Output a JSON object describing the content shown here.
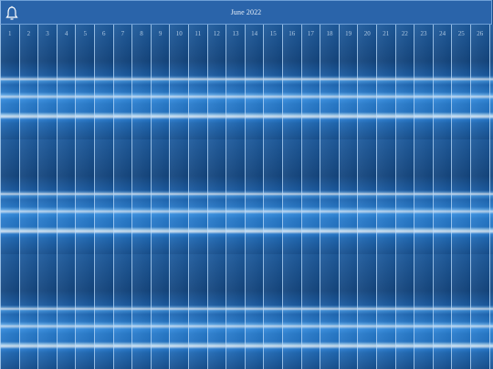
{
  "header": {
    "title": "June 2022",
    "bell_icon": "bell-icon"
  },
  "days": [
    "1",
    "2",
    "3",
    "4",
    "5",
    "6",
    "7",
    "8",
    "9",
    "10",
    "11",
    "12",
    "13",
    "14",
    "15",
    "16",
    "17",
    "18",
    "19",
    "20",
    "21",
    "22",
    "23",
    "24",
    "25",
    "26",
    "27",
    "28"
  ],
  "colors": {
    "header_bg": "#2a64aa",
    "header_border": "#6e9fd6",
    "day_divider": "#bedcfa"
  }
}
